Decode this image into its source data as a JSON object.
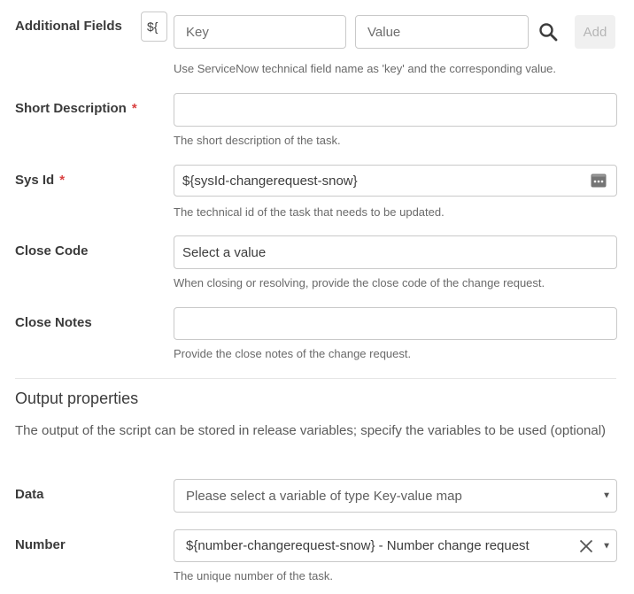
{
  "additional_fields": {
    "label": "Additional Fields",
    "var_toggle": "${",
    "key_placeholder": "Key",
    "value_placeholder": "Value",
    "add_label": "Add",
    "help": "Use ServiceNow technical field name as 'key' and the corresponding value."
  },
  "short_description": {
    "label": "Short Description",
    "required_mark": "*",
    "value": "",
    "help": "The short description of the task."
  },
  "sys_id": {
    "label": "Sys Id",
    "required_mark": "*",
    "value": "${sysId-changerequest-snow}",
    "help": "The technical id of the task that needs to be updated."
  },
  "close_code": {
    "label": "Close Code",
    "placeholder": "Select a value",
    "help": "When closing or resolving, provide the close code of the change request."
  },
  "close_notes": {
    "label": "Close Notes",
    "value": "",
    "help": "Provide the close notes of the change request."
  },
  "output": {
    "title": "Output properties",
    "description": "The output of the script can be stored in release variables; specify the variables to be used (optional)"
  },
  "data_field": {
    "label": "Data",
    "placeholder": "Please select a variable of type Key-value map"
  },
  "number_field": {
    "label": "Number",
    "value": "${number-changerequest-snow} - Number change request",
    "help": "The unique number of the task."
  },
  "colors": {
    "required": "#d94141",
    "border": "#c9c9c9",
    "help_text": "#6a6a6a"
  }
}
